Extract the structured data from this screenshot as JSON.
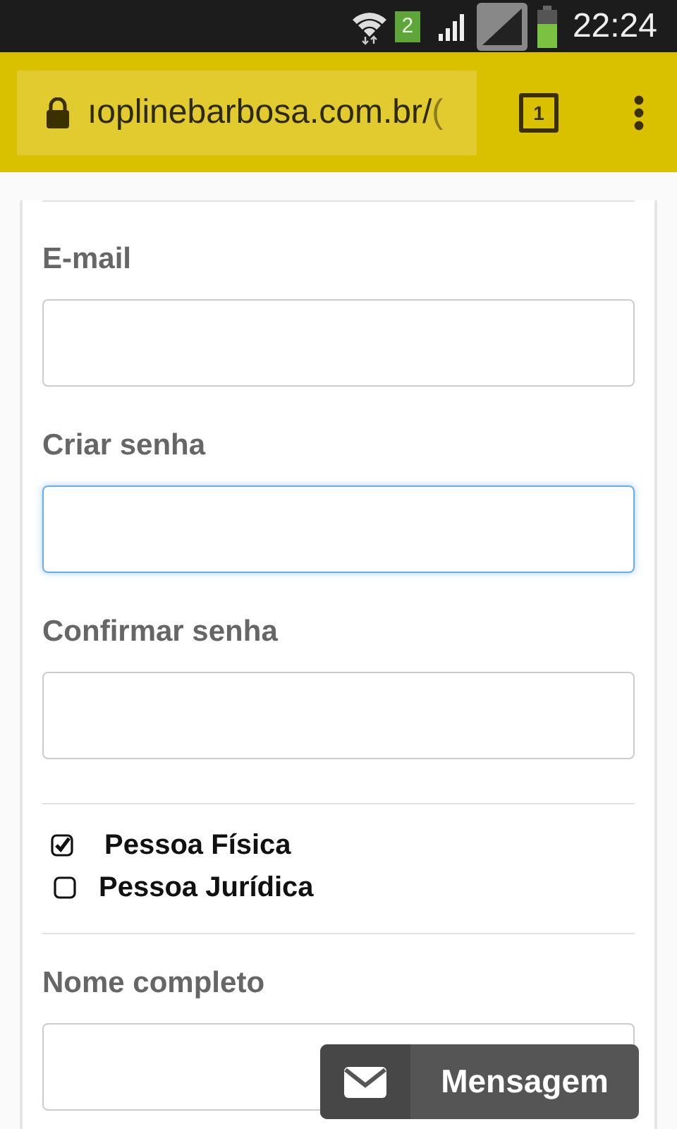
{
  "status_bar": {
    "sim_badge": "2",
    "time": "22:24"
  },
  "browser_toolbar": {
    "url": "ıoplinebarbosa.com.br/",
    "url_cut": "(",
    "tab_count": "1"
  },
  "form": {
    "fields": [
      {
        "label": "E-mail",
        "focused": false
      },
      {
        "label": "Criar senha",
        "focused": true
      },
      {
        "label": "Confirmar senha",
        "focused": false
      }
    ],
    "person_types": [
      {
        "label": "Pessoa Física",
        "checked": true
      },
      {
        "label": "Pessoa Jurídica",
        "checked": false
      }
    ],
    "name_field": {
      "label": "Nome completo",
      "focused": false
    }
  },
  "message_button": {
    "label": "Mensagem"
  }
}
